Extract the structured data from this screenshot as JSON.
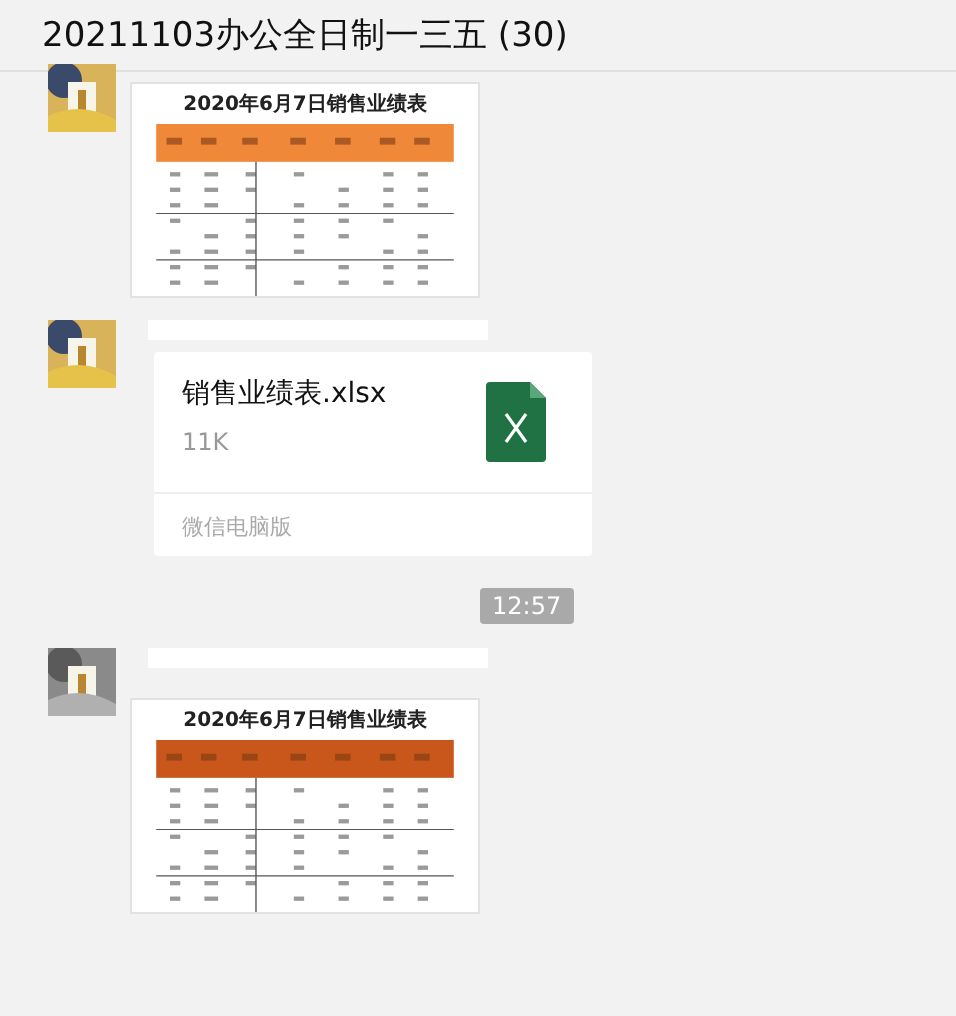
{
  "window": {
    "title": "20211103办公全日制一三五 (30)"
  },
  "messages": [
    {
      "title": "2020年6月7日销售业绩表",
      "color": "#f0883a"
    },
    {
      "kind": "file",
      "file_name": "销售业绩表.xlsx",
      "file_size": "11K",
      "source": "微信电脑版"
    },
    {
      "kind": "time",
      "text": "12:57"
    },
    {
      "title": "2020年6月7日销售业绩表",
      "color": "#c9571b"
    }
  ]
}
